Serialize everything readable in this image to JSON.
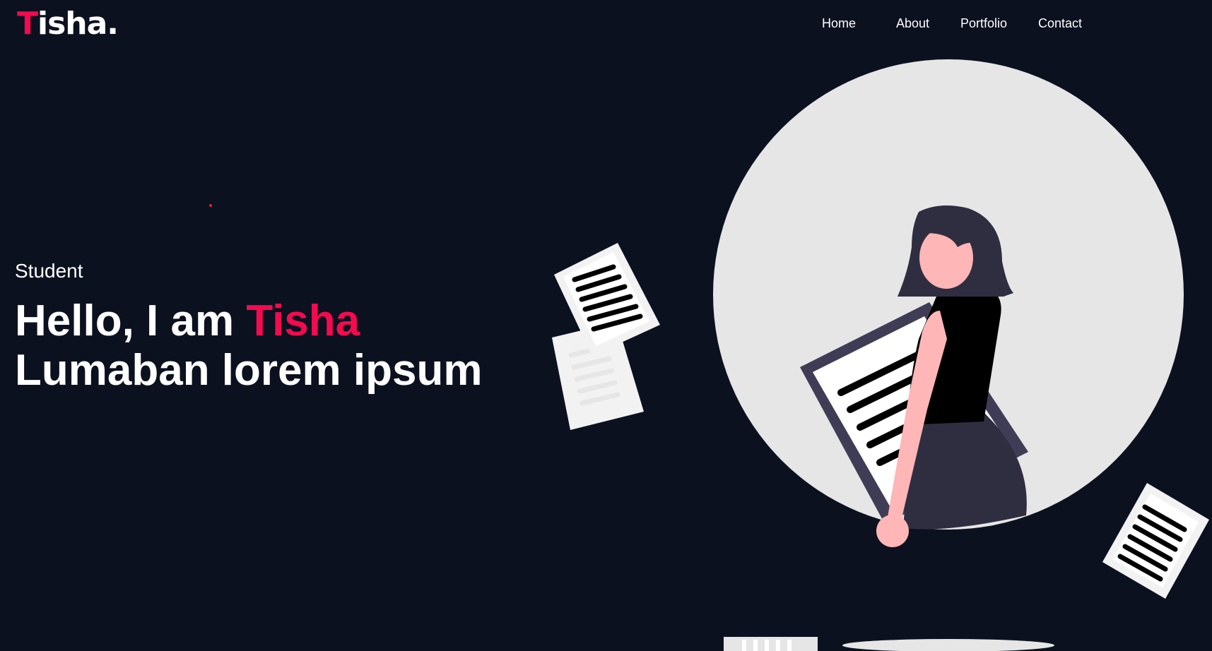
{
  "brand": {
    "logo_first": "T",
    "logo_rest": "isha."
  },
  "nav": {
    "items": [
      {
        "label": "Home"
      },
      {
        "label": "About"
      },
      {
        "label": "Portfolio"
      },
      {
        "label": "Contact"
      }
    ]
  },
  "hero": {
    "subtitle": "Student",
    "greeting": "Hello, I am ",
    "name": "Tisha",
    "name_rest": "Lumaban lorem ipsum"
  },
  "colors": {
    "background": "#0c1120",
    "accent": "#f50a4f",
    "text": "#ffffff",
    "circle": "#e6e6e6",
    "paper": "#f2f2f2",
    "dark_fig": "#3f3d56",
    "skin": "#ffb6b6"
  },
  "icons": {
    "illustration": "woman-holding-document-illustration"
  }
}
